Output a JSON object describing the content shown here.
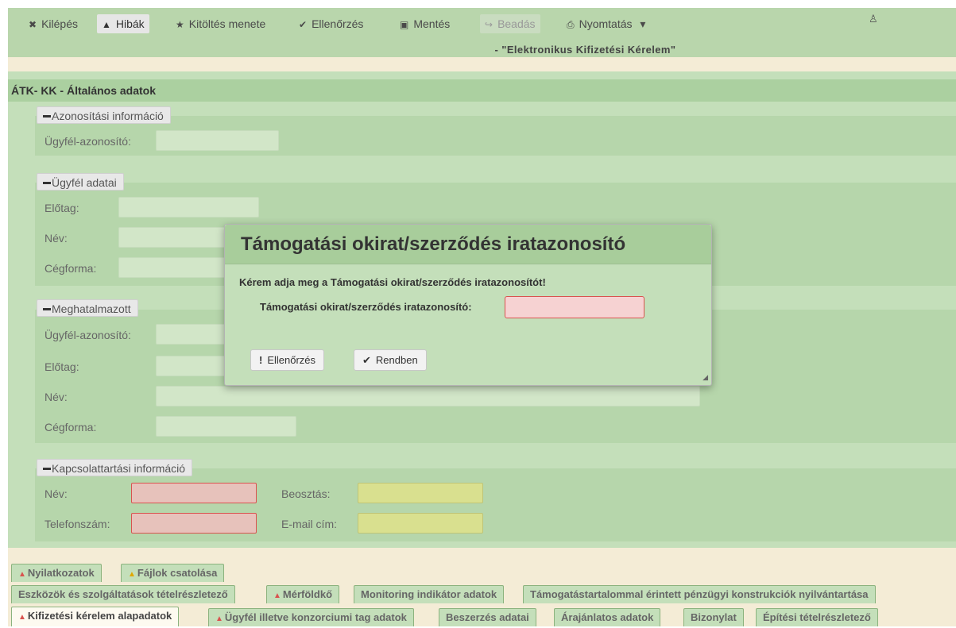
{
  "toolbar": {
    "items": [
      {
        "icon": "✖",
        "label": "Kilépés"
      },
      {
        "icon": "▲",
        "label": "Hibák"
      },
      {
        "icon": "★",
        "label": "Kitöltés menete"
      },
      {
        "icon": "✔",
        "label": "Ellenőrzés"
      },
      {
        "icon": "▣",
        "label": "Mentés"
      },
      {
        "icon": "↪",
        "label": "Beadás"
      },
      {
        "icon": "⎙",
        "label": "Nyomtatás",
        "caret": "▾"
      }
    ],
    "user_icon": "♙",
    "title": "- \"Elektronikus Kifizetési Kérelem\""
  },
  "panel": {
    "header": "ÁTK- KK - Általános adatok",
    "sections": {
      "azonositasi": {
        "legend": "Azonosítási információ",
        "labels": [
          "Ügyfél-azonosító:"
        ]
      },
      "ugyfel": {
        "legend": "Ügyfél adatai",
        "labels": [
          "Előtag:",
          "Név:",
          "Cégforma:"
        ]
      },
      "meghatalmazott": {
        "legend": "Meghatalmazott",
        "labels": [
          "Ügyfél-azonosító:",
          "Előtag:",
          "Név:",
          "Cégforma:"
        ]
      },
      "kapcsolat": {
        "legend": "Kapcsolattartási információ",
        "labels": [
          "Név:",
          "Telefonszám:",
          "Beosztás:",
          "E-mail cím:"
        ]
      }
    }
  },
  "tabs": {
    "row1": [
      {
        "label": "Nyilatkozatok",
        "warn": "red"
      },
      {
        "label": "Fájlok csatolása",
        "warn": "yellow"
      }
    ],
    "row2": [
      {
        "label": "Eszközök és szolgáltatások tételrészletező",
        "warn": ""
      },
      {
        "label": "Mérföldkő",
        "warn": "red"
      },
      {
        "label": "Monitoring indikátor adatok",
        "warn": ""
      },
      {
        "label": "Támogatástartalommal érintett pénzügyi konstrukciók nyilvántartása",
        "warn": ""
      }
    ],
    "row3": [
      {
        "label": "Kifizetési kérelem alapadatok",
        "warn": "red"
      },
      {
        "label": "Ügyfél illetve konzorciumi tag adatok",
        "warn": "red"
      },
      {
        "label": "Beszerzés adatai",
        "warn": ""
      },
      {
        "label": "Árajánlatos adatok",
        "warn": ""
      },
      {
        "label": "Bizonylat",
        "warn": ""
      },
      {
        "label": "Építési tételrészletező",
        "warn": ""
      }
    ]
  },
  "modal": {
    "title": "Támogatási okirat/szerződés iratazonosító",
    "message": "Kérem adja meg a Támogatási okirat/szerződés iratazonosítót!",
    "field_label": "Támogatási okirat/szerződés iratazonosító:",
    "field_value": "",
    "buttons": {
      "check_icon": "!",
      "check": "Ellenőrzés",
      "ok_icon": "✔",
      "ok": "Rendben"
    },
    "grip": "◢"
  },
  "colors": {
    "error": "#d9534f",
    "warning": "#e0a800",
    "toolbar": "#b9d6ac",
    "panel": "#c4dfba"
  }
}
